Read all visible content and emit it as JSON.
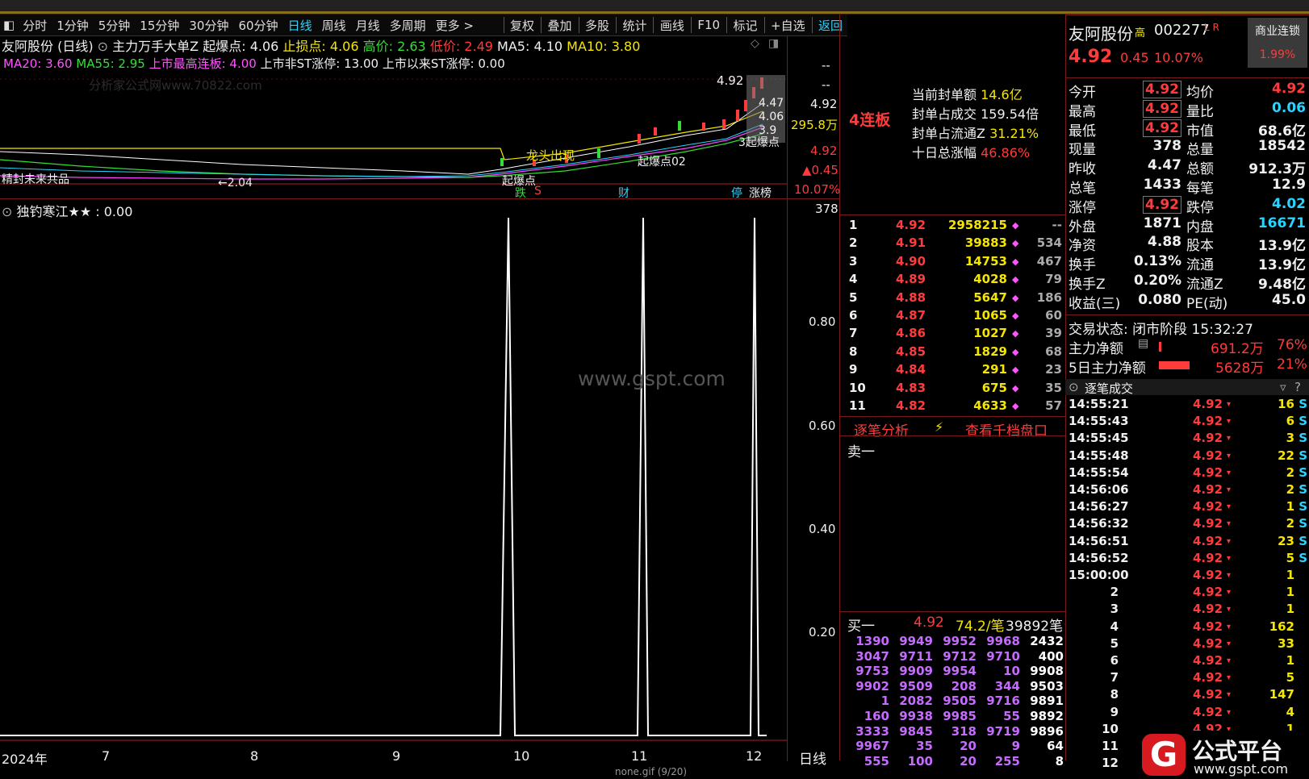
{
  "toolbar": {
    "items": [
      "分时",
      "1分钟",
      "5分钟",
      "15分钟",
      "30分钟",
      "60分钟",
      "日线",
      "周线",
      "月线",
      "多周期",
      "更多 >"
    ],
    "actions": [
      "复权",
      "叠加",
      "多股",
      "统计",
      "画线",
      "F10",
      "标记",
      "+自选",
      "返回"
    ]
  },
  "chart_header": {
    "stock_label": "友阿股份 (日线)",
    "indicator": "主力万手大单Z 起爆点: 4.06",
    "stop": "止损点: 4.06",
    "high": "高价: 2.63",
    "low": "低价: 2.49",
    "ma5": "MA5: 4.10",
    "ma10": "MA10: 3.80",
    "ma20": "MA20: 3.60",
    "ma55": "MA55: 2.95",
    "max_limit": "上市最高连板: 4.00",
    "non_st": "上市非ST涨停: 13.00",
    "since_st": "上市以来ST涨停: 0.00"
  },
  "kline_labels": {
    "price_label": "4.92",
    "label_447": "4.47",
    "label_406": "4.06",
    "label_39": "3.9",
    "label_204": "←2.04",
    "signal1": "龙头出现",
    "signal2": "起爆点02",
    "signal3": "起爆点",
    "signal4": "3起爆点",
    "left_label": "精封未来共品",
    "tag_die": "跌",
    "tag_s": "S",
    "tag_cai": "财",
    "tag_ting": "停",
    "tag_zhangbang": "涨榜"
  },
  "axis_right": {
    "dash1": "--",
    "dash2": "--",
    "p492": "4.92",
    "vol": "295.8万",
    "p492b": "4.92",
    "chg": "▲0.45",
    "pct": "10.07%",
    "v378": "378",
    "t080": "0.80",
    "t060": "0.60",
    "t040": "0.40",
    "t020": "0.20",
    "period": "日线"
  },
  "sub_indicator": {
    "label": "独钓寒江★★ : 0.00"
  },
  "x_axis": {
    "labels": [
      "2024年",
      "7",
      "8",
      "9",
      "10",
      "11",
      "12"
    ]
  },
  "watermark": "www.gspt.com",
  "watermark_small": "分析家公式网www.70822.com",
  "board_info": {
    "tag": "4连板",
    "amount_label": "当前封单额",
    "amount": "14.6亿",
    "ratio_label": "封单占成交",
    "ratio": "159.54倍",
    "float_label": "封单占流通Z",
    "float": "31.21%",
    "ten_label": "十日总涨幅",
    "ten": "46.86%"
  },
  "order_book": {
    "rows": [
      {
        "n": "1",
        "price": "4.92",
        "vol": "2958215",
        "extra": "--"
      },
      {
        "n": "2",
        "price": "4.91",
        "vol": "39883",
        "extra": "534"
      },
      {
        "n": "3",
        "price": "4.90",
        "vol": "14753",
        "extra": "467"
      },
      {
        "n": "4",
        "price": "4.89",
        "vol": "4028",
        "extra": "79"
      },
      {
        "n": "5",
        "price": "4.88",
        "vol": "5647",
        "extra": "186"
      },
      {
        "n": "6",
        "price": "4.87",
        "vol": "1065",
        "extra": "60"
      },
      {
        "n": "7",
        "price": "4.86",
        "vol": "1027",
        "extra": "39"
      },
      {
        "n": "8",
        "price": "4.85",
        "vol": "1829",
        "extra": "68"
      },
      {
        "n": "9",
        "price": "4.84",
        "vol": "291",
        "extra": "23"
      },
      {
        "n": "10",
        "price": "4.83",
        "vol": "675",
        "extra": "35"
      },
      {
        "n": "11",
        "price": "4.82",
        "vol": "4633",
        "extra": "57"
      }
    ],
    "link1": "逐笔分析",
    "link2": "查看千档盘口",
    "sell_label": "卖一",
    "buy_label": "买一",
    "buy_price": "4.92",
    "buy_avg": "74.2/笔",
    "buy_count": "39892笔",
    "queue": [
      [
        "1390",
        "9949",
        "9952",
        "9968",
        "2432"
      ],
      [
        "3047",
        "9711",
        "9712",
        "9710",
        "400"
      ],
      [
        "9753",
        "9909",
        "9954",
        "10",
        "9908"
      ],
      [
        "9902",
        "9509",
        "208",
        "344",
        "9503"
      ],
      [
        "1",
        "2082",
        "9505",
        "9716",
        "9891"
      ],
      [
        "160",
        "9938",
        "9985",
        "55",
        "9892"
      ],
      [
        "3333",
        "9845",
        "318",
        "9719",
        "9896"
      ],
      [
        "9967",
        "35",
        "20",
        "9",
        "64"
      ],
      [
        "555",
        "100",
        "20",
        "255",
        "8"
      ]
    ]
  },
  "quote": {
    "name": "友阿股份",
    "name_mark": "高",
    "code": "002277",
    "badge": "L R",
    "price": "4.92",
    "chg": "0.45",
    "pct": "10.07%",
    "sector": "商业连锁",
    "sector_pct": "1.99%",
    "rows": [
      {
        "l1": "今开",
        "v1": "4.92",
        "l2": "均价",
        "v2": "4.92"
      },
      {
        "l1": "最高",
        "v1": "4.92",
        "l2": "量比",
        "v2": "0.06"
      },
      {
        "l1": "最低",
        "v1": "4.92",
        "l2": "市值",
        "v2": "68.6亿"
      },
      {
        "l1": "现量",
        "v1": "378",
        "l2": "总量",
        "v2": "18542"
      },
      {
        "l1": "昨收",
        "v1": "4.47",
        "l2": "总额",
        "v2": "912.3万"
      },
      {
        "l1": "总笔",
        "v1": "1433",
        "l2": "每笔",
        "v2": "12.9"
      },
      {
        "l1": "涨停",
        "v1": "4.92",
        "l2": "跌停",
        "v2": "4.02"
      },
      {
        "l1": "外盘",
        "v1": "1871",
        "l2": "内盘",
        "v2": "16671"
      },
      {
        "l1": "净资",
        "v1": "4.88",
        "l2": "股本",
        "v2": "13.9亿"
      },
      {
        "l1": "换手",
        "v1": "0.13%",
        "l2": "流通",
        "v2": "13.9亿"
      },
      {
        "l1": "换手Z",
        "v1": "0.20%",
        "l2": "流通Z",
        "v2": "9.48亿"
      },
      {
        "l1": "收益(三)",
        "v1": "0.080",
        "l2": "PE(动)",
        "v2": "45.0"
      }
    ],
    "trade_state_label": "交易状态: 闭市阶段",
    "trade_time": "15:32:27",
    "main_net_label": "主力净额",
    "main_net": "691.2万",
    "main_net_pct": "76%",
    "main5_label": "5日主力净额",
    "main5": "5628万",
    "main5_pct": "21%"
  },
  "ticks": {
    "title": "逐笔成交",
    "rows": [
      {
        "t": "14:55:21",
        "p": "4.92",
        "v": "16",
        "f": "S"
      },
      {
        "t": "14:55:43",
        "p": "4.92",
        "v": "6",
        "f": "S"
      },
      {
        "t": "14:55:45",
        "p": "4.92",
        "v": "3",
        "f": "S"
      },
      {
        "t": "14:55:48",
        "p": "4.92",
        "v": "22",
        "f": "S"
      },
      {
        "t": "14:55:54",
        "p": "4.92",
        "v": "2",
        "f": "S"
      },
      {
        "t": "14:56:06",
        "p": "4.92",
        "v": "2",
        "f": "S"
      },
      {
        "t": "14:56:27",
        "p": "4.92",
        "v": "1",
        "f": "S"
      },
      {
        "t": "14:56:32",
        "p": "4.92",
        "v": "2",
        "f": "S"
      },
      {
        "t": "14:56:51",
        "p": "4.92",
        "v": "23",
        "f": "S"
      },
      {
        "t": "14:56:52",
        "p": "4.92",
        "v": "5",
        "f": "S"
      },
      {
        "t": "15:00:00",
        "p": "4.92",
        "v": "1",
        "f": ""
      },
      {
        "t": "2",
        "p": "4.92",
        "v": "1",
        "f": ""
      },
      {
        "t": "3",
        "p": "4.92",
        "v": "1",
        "f": ""
      },
      {
        "t": "4",
        "p": "4.92",
        "v": "162",
        "f": ""
      },
      {
        "t": "5",
        "p": "4.92",
        "v": "33",
        "f": ""
      },
      {
        "t": "6",
        "p": "4.92",
        "v": "1",
        "f": ""
      },
      {
        "t": "7",
        "p": "4.92",
        "v": "5",
        "f": ""
      },
      {
        "t": "8",
        "p": "4.92",
        "v": "147",
        "f": ""
      },
      {
        "t": "9",
        "p": "4.92",
        "v": "4",
        "f": ""
      },
      {
        "t": "10",
        "p": "4.92",
        "v": "1",
        "f": ""
      },
      {
        "t": "11",
        "p": "4.92",
        "v": "1",
        "f": ""
      },
      {
        "t": "12",
        "p": "4.92",
        "v": "1",
        "f": ""
      }
    ]
  },
  "logo": {
    "text": "公式平台",
    "url": "www.gspt.com"
  },
  "status": {
    "file": "none.gif (9/20)"
  }
}
